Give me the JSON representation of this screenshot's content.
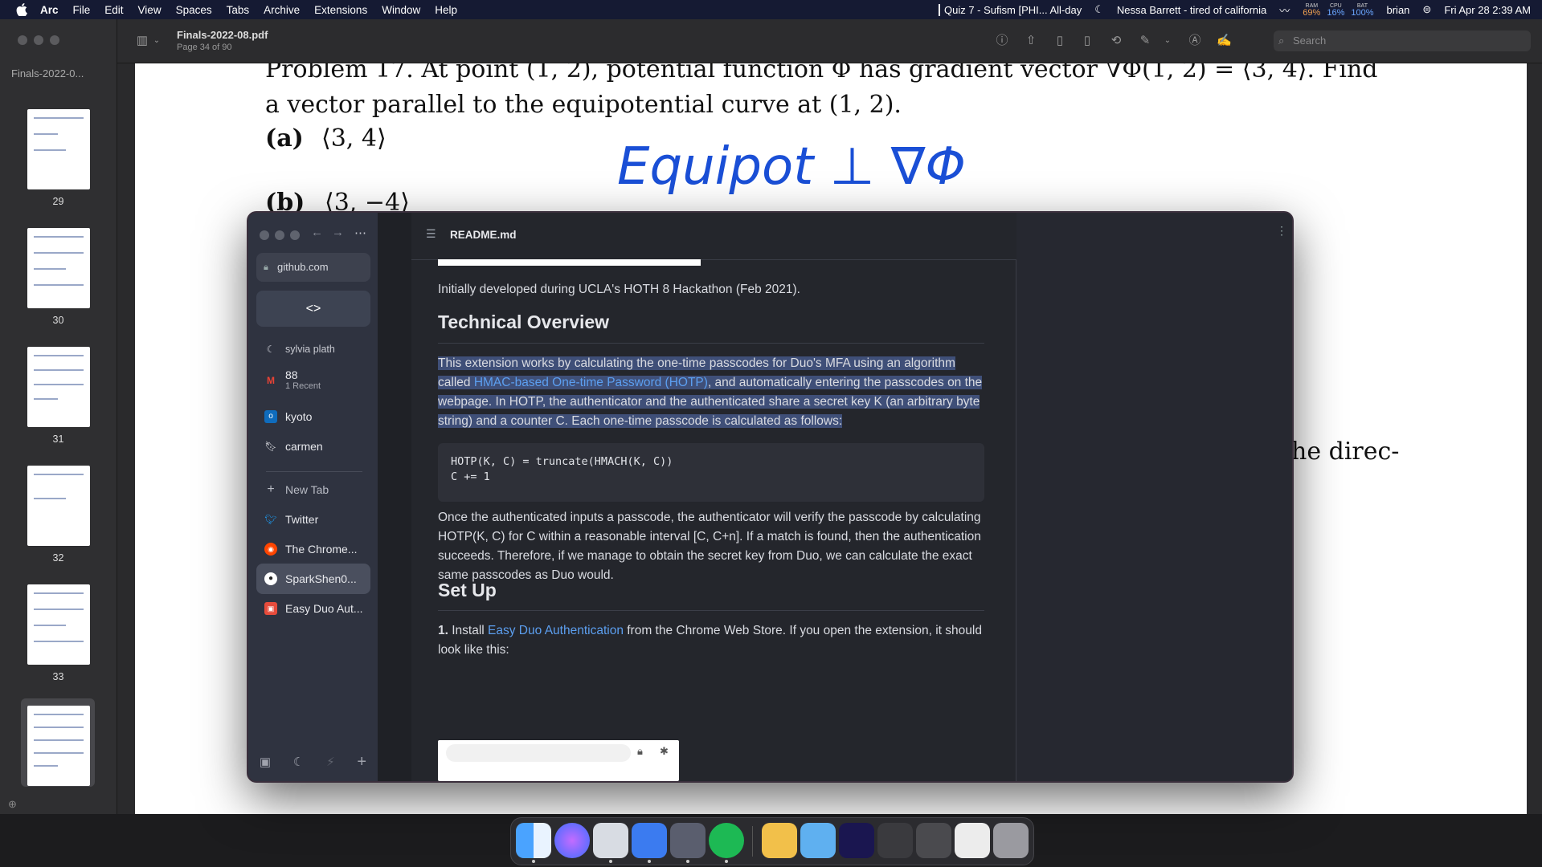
{
  "menubar": {
    "app": "Arc",
    "items": [
      "File",
      "Edit",
      "View",
      "Spaces",
      "Tabs",
      "Archive",
      "Extensions",
      "Window",
      "Help"
    ],
    "calendar": "Quiz 7 - Sufism [PHI... All-day",
    "now_playing": "Nessa Barrett - tired of california",
    "ram_label": "RAM",
    "ram": "69%",
    "cpu_label": "CPU",
    "cpu": "16%",
    "bat_label": "BAT",
    "bat": "100%",
    "user": "brian",
    "datetime": "Fri Apr 28  2:39 AM"
  },
  "preview": {
    "doc_label": "Finals-2022-0...",
    "title": "Finals-2022-08.pdf",
    "subtitle": "Page 34 of 90",
    "search_placeholder": "Search",
    "thumb_numbers": [
      "29",
      "30",
      "31",
      "32",
      "33"
    ],
    "page_lines": {
      "line1": "Problem 17.   At point (1, 2), potential function Φ has gradient vector ∇Φ(1, 2) = ⟨3, 4⟩. Find",
      "line2": "a vector parallel to the equipotential curve at (1, 2).",
      "opt_a_label": "(a)",
      "opt_a": "⟨3, 4⟩",
      "opt_b_label": "(b)",
      "opt_b": "⟨3, −4⟩",
      "right_fragment": "he direc-"
    },
    "handwriting": "Equipot  ⊥  ∇Φ"
  },
  "arc": {
    "url": "github.com",
    "dev_label": "<>",
    "pinned": [
      {
        "label": "sylvia plath"
      },
      {
        "label": "88",
        "sub": "1 Recent"
      },
      {
        "label": "kyoto"
      },
      {
        "label": "carmen"
      }
    ],
    "new_tab": "New Tab",
    "tabs": [
      {
        "label": "Twitter"
      },
      {
        "label": "The Chrome..."
      },
      {
        "label": "SparkShen0..."
      },
      {
        "label": "Easy Duo Aut..."
      }
    ],
    "file_name": "README.md",
    "readme": {
      "intro": "Initially developed during UCLA's HOTH 8 Hackathon (Feb 2021).",
      "h_technical": "Technical Overview",
      "p1_a": "This extension works by calculating the one-time passcodes for Duo's MFA using an algorithm called ",
      "p1_link": "HMAC-based One-time Password (HOTP)",
      "p1_b": ", and automatically entering the passcodes on the webpage. In HOTP, the authenticator and the authenticated share a secret key K (an arbitrary byte string) and a counter C. Each one-time passcode is calculated as follows:",
      "code": "HOTP(K, C) = truncate(HMACH(K, C))\nC += 1",
      "p2": "Once the authenticated inputs a passcode, the authenticator will verify the passcode by calculating HOTP(K, C) for C within a reasonable interval [C, C+n]. If a match is found, then the authentication succeeds. Therefore, if we manage to obtain the secret key from Duo, we can calculate the exact same passcodes as Duo would.",
      "h_setup": "Set Up",
      "step1_num": "1.",
      "step1_a": " Install ",
      "step1_link": "Easy Duo Authentication",
      "step1_b": " from the Chrome Web Store. If you open the extension, it should look like this:"
    }
  },
  "dock": {
    "apps": [
      "Finder",
      "Siri",
      "Preview",
      "Pages",
      "Affinity",
      "Spotify",
      "Notes",
      "Folder",
      "Applications",
      "After Effects",
      "Screenshots",
      "Trash"
    ]
  },
  "colors": {
    "accent": "#5c9ff0",
    "highlight": "#3f4f78",
    "handwriting": "#1a4fd6"
  }
}
